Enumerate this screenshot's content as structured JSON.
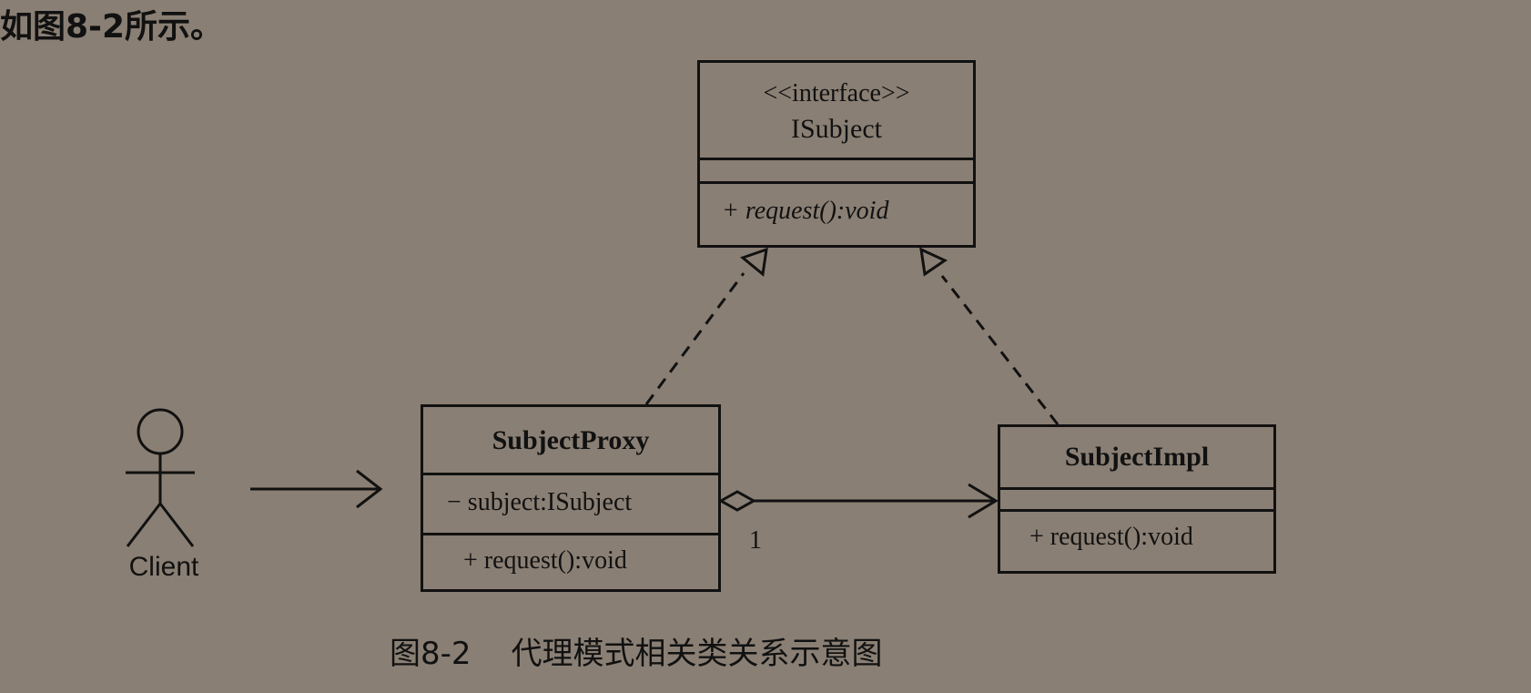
{
  "intro_text": "如图8-2所示。",
  "diagram": {
    "interface_box": {
      "stereotype": "<<interface>>",
      "name": "ISubject",
      "operation": "+ request():void"
    },
    "proxy_box": {
      "name": "SubjectProxy",
      "attribute": "− subject:ISubject",
      "operation": "+ request():void"
    },
    "impl_box": {
      "name": "SubjectImpl",
      "operation": "+ request():void"
    },
    "actor_label": "Client",
    "multiplicity": "1"
  },
  "caption": {
    "figure_number": "图8-2",
    "title": "代理模式相关类关系示意图"
  }
}
